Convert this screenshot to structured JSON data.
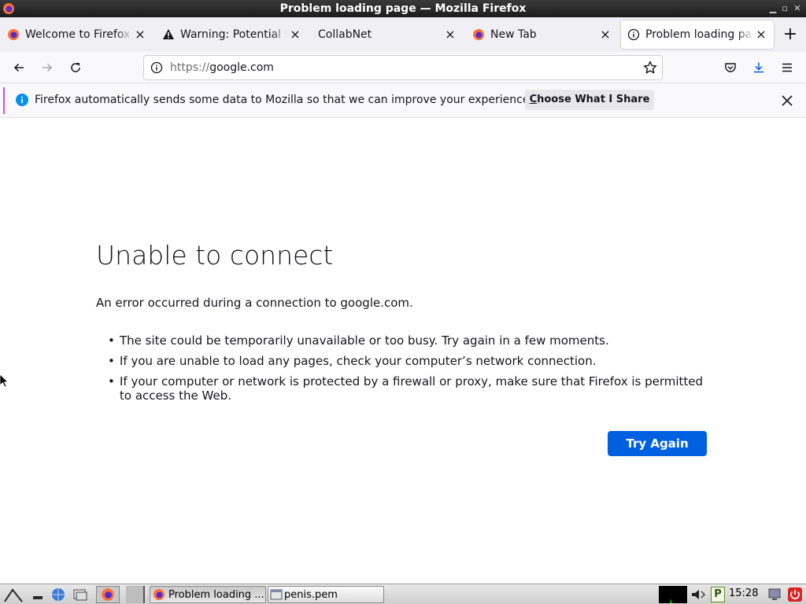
{
  "window": {
    "title": "Problem loading page — Mozilla Firefox"
  },
  "tabs": [
    {
      "title": "Welcome to Firefox",
      "icon": "firefox-logo-icon",
      "active": false
    },
    {
      "title": "Warning: Potential Security Risk Ahead",
      "icon": "warning-icon",
      "active": false
    },
    {
      "title": "CollabNet",
      "icon": "none",
      "active": false
    },
    {
      "title": "New Tab",
      "icon": "firefox-logo-icon",
      "active": false
    },
    {
      "title": "Problem loading page",
      "icon": "info-icon",
      "active": true
    }
  ],
  "url": {
    "scheme": "https://",
    "host": "google.com"
  },
  "notification": {
    "message": "Firefox automatically sends some data to Mozilla so that we can improve your experience.",
    "button_access_key": "C",
    "button_rest": "hoose What I Share"
  },
  "error_page": {
    "title": "Unable to connect",
    "description": "An error occurred during a connection to google.com.",
    "suggestions": [
      "The site could be temporarily unavailable or too busy. Try again in a few moments.",
      "If you are unable to load any pages, check your computer’s network connection.",
      "If your computer or network is protected by a firewall or proxy, make sure that Firefox is permitted to access the Web."
    ],
    "try_again_label": "Try Again"
  },
  "taskbar": {
    "tasks": [
      {
        "label": "Problem loading ...",
        "icon": "firefox-logo-icon",
        "active": true
      },
      {
        "label": "penis.pem",
        "icon": "window-icon",
        "active": false
      }
    ],
    "clock": "15:28",
    "tray_letter": "P"
  },
  "colors": {
    "accent_blue": "#0061e0",
    "titlebar": "#1c1c1c",
    "tabstrip": "#f0f0f4"
  }
}
